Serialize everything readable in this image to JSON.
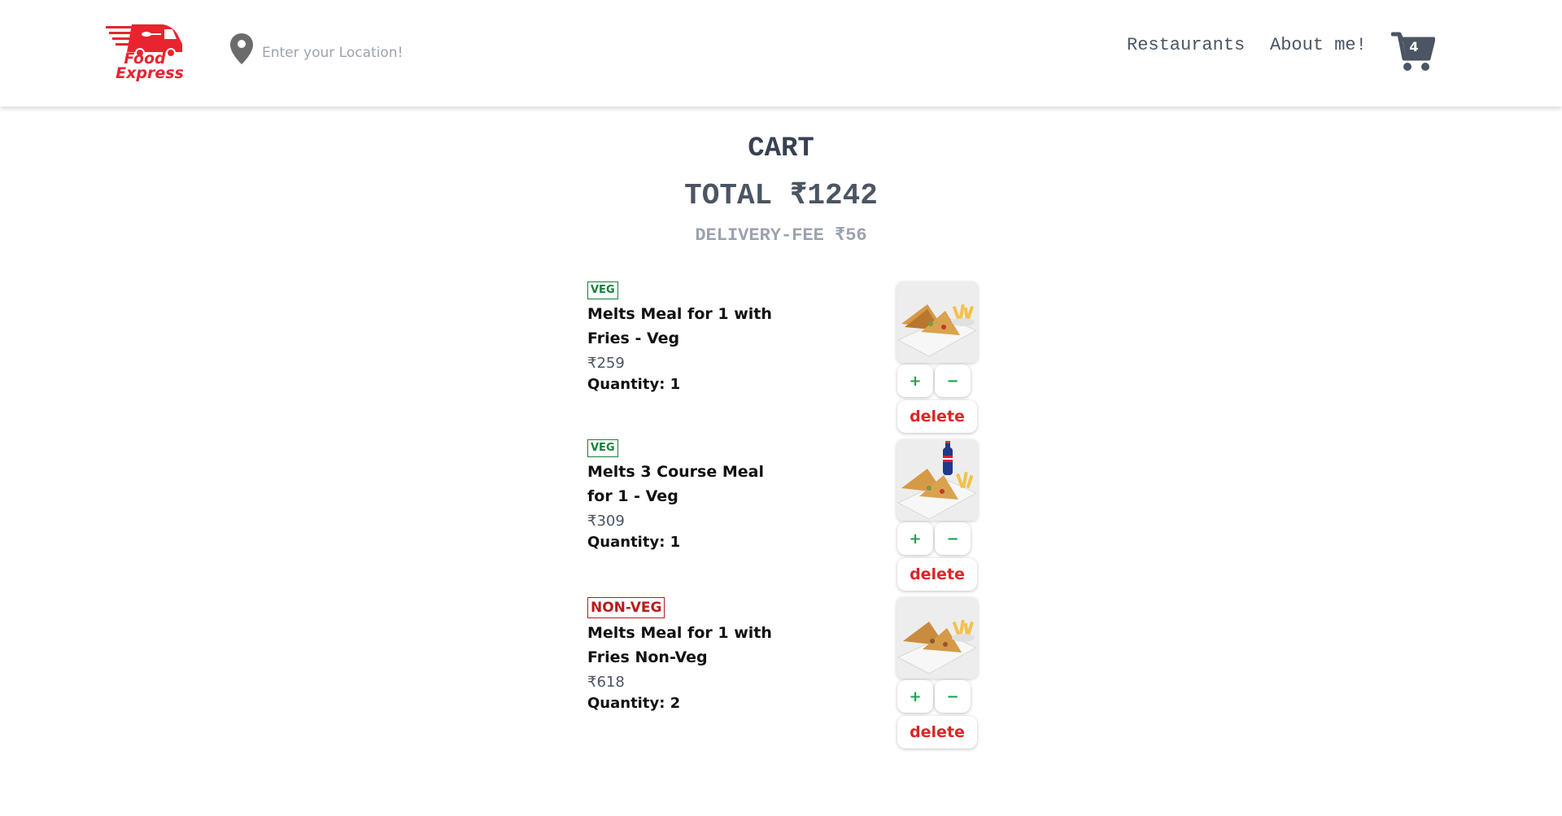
{
  "header": {
    "logo_text_line1": "Food",
    "logo_text_line2": "Express",
    "location_placeholder": "Enter your Location!",
    "nav": {
      "restaurants": "Restaurants",
      "about": "About me!"
    },
    "cart_count": "4",
    "brand_color": "#e8242f"
  },
  "cart": {
    "title": "CART",
    "total": "TOTAL ₹1242",
    "delivery_fee": "DELIVERY-FEE ₹56"
  },
  "items": [
    {
      "badge": "VEG",
      "name": "Melts Meal for 1 with Fries - Veg",
      "price": "₹259",
      "quantity": "Quantity: 1",
      "image": "melt-with-fries-image"
    },
    {
      "badge": "VEG",
      "name": "Melts 3 Course Meal for 1 - Veg",
      "price": "₹309",
      "quantity": "Quantity: 1",
      "image": "melt-with-fries-and-drink-image"
    },
    {
      "badge": "NON-VEG",
      "name": "Melts Meal for 1 with Fries Non-Veg",
      "price": "₹618",
      "quantity": "Quantity: 2",
      "image": "melt-with-fries-image"
    }
  ],
  "buttons": {
    "plus": "+",
    "minus": "−",
    "delete": "delete"
  },
  "colors": {
    "veg": "#15803d",
    "nonveg": "#b91c1c",
    "delete": "#dc2626",
    "plus_minus": "#16a34a"
  }
}
